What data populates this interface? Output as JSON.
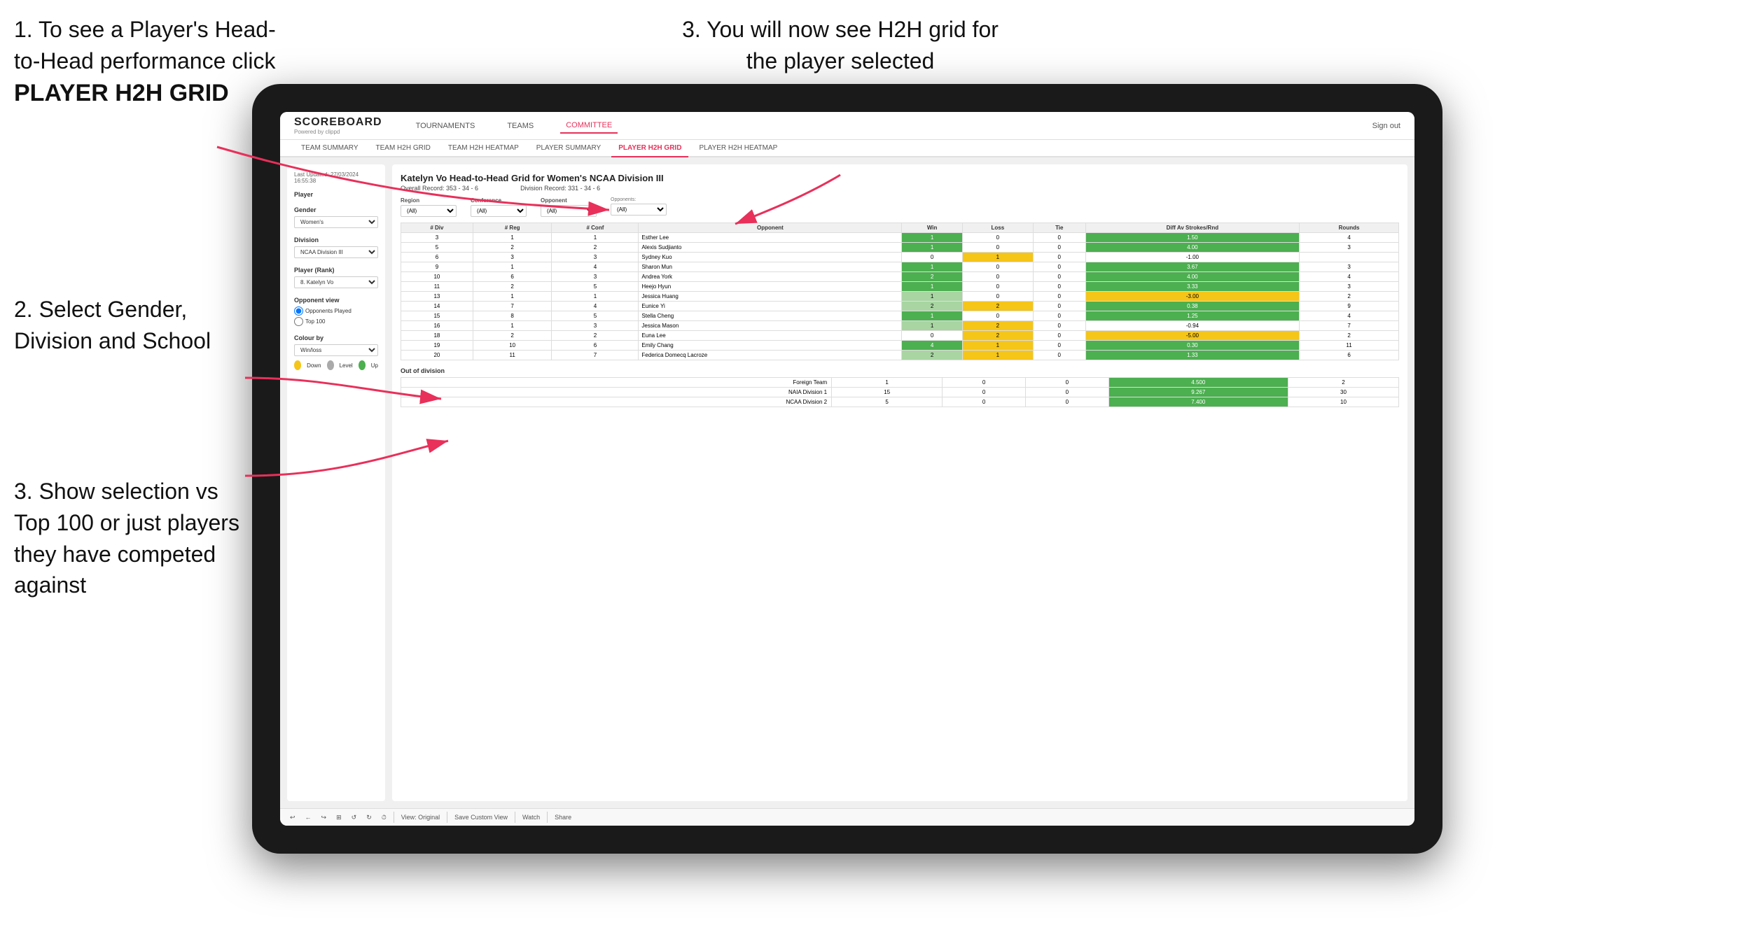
{
  "instructions": {
    "step1": "1. To see a Player's Head-to-Head performance click",
    "step1_bold": "PLAYER H2H GRID",
    "step3_top": "3. You will now see H2H grid for the player selected",
    "step2": "2. Select Gender, Division and School",
    "step3_bottom": "3. Show selection vs Top 100 or just players they have competed against"
  },
  "header": {
    "logo": "SCOREBOARD",
    "logo_sub": "Powered by clippd",
    "nav_items": [
      "TOURNAMENTS",
      "TEAMS",
      "COMMITTEE"
    ],
    "active_nav": "COMMITTEE",
    "sign_out": "Sign out"
  },
  "sub_nav": {
    "items": [
      "TEAM SUMMARY",
      "TEAM H2H GRID",
      "TEAM H2H HEATMAP",
      "PLAYER SUMMARY",
      "PLAYER H2H GRID",
      "PLAYER H2H HEATMAP"
    ],
    "active": "PLAYER H2H GRID"
  },
  "left_panel": {
    "last_updated_label": "Last Updated: 27/03/2024",
    "last_updated_time": "16:55:38",
    "player_label": "Player",
    "gender_label": "Gender",
    "gender_value": "Women's",
    "division_label": "Division",
    "division_value": "NCAA Division III",
    "player_rank_label": "Player (Rank)",
    "player_rank_value": "8. Katelyn Vo",
    "opponent_view_label": "Opponent view",
    "radio_played": "Opponents Played",
    "radio_top100": "Top 100",
    "colour_label": "Colour by",
    "colour_value": "Win/loss",
    "dot_down": "Down",
    "dot_level": "Level",
    "dot_up": "Up"
  },
  "grid": {
    "title": "Katelyn Vo Head-to-Head Grid for Women's NCAA Division III",
    "overall_record": "Overall Record: 353 - 34 - 6",
    "division_record": "Division Record: 331 - 34 - 6",
    "region_label": "Region",
    "conference_label": "Conference",
    "opponent_label": "Opponent",
    "opponents_label": "Opponents:",
    "all_option": "(All)",
    "columns": [
      "# Div",
      "# Reg",
      "# Conf",
      "Opponent",
      "Win",
      "Loss",
      "Tie",
      "Diff Av Strokes/Rnd",
      "Rounds"
    ],
    "rows": [
      {
        "div": 3,
        "reg": 1,
        "conf": 1,
        "opponent": "Esther Lee",
        "win": 1,
        "loss": 0,
        "tie": 0,
        "diff": 1.5,
        "rounds": 4,
        "win_color": "green",
        "loss_color": "white",
        "tie_color": "white"
      },
      {
        "div": 5,
        "reg": 2,
        "conf": 2,
        "opponent": "Alexis Sudjianto",
        "win": 1,
        "loss": 0,
        "tie": 0,
        "diff": 4.0,
        "rounds": 3,
        "win_color": "green",
        "loss_color": "white",
        "tie_color": "white"
      },
      {
        "div": 6,
        "reg": 3,
        "conf": 3,
        "opponent": "Sydney Kuo",
        "win": 0,
        "loss": 1,
        "tie": 0,
        "diff": -1.0,
        "rounds": "",
        "win_color": "white",
        "loss_color": "yellow",
        "tie_color": "white"
      },
      {
        "div": 9,
        "reg": 1,
        "conf": 4,
        "opponent": "Sharon Mun",
        "win": 1,
        "loss": 0,
        "tie": 0,
        "diff": 3.67,
        "rounds": 3,
        "win_color": "green",
        "loss_color": "white",
        "tie_color": "white"
      },
      {
        "div": 10,
        "reg": 6,
        "conf": 3,
        "opponent": "Andrea York",
        "win": 2,
        "loss": 0,
        "tie": 0,
        "diff": 4.0,
        "rounds": 4,
        "win_color": "green",
        "loss_color": "white",
        "tie_color": "white"
      },
      {
        "div": 11,
        "reg": 2,
        "conf": 5,
        "opponent": "Heejo Hyun",
        "win": 1,
        "loss": 0,
        "tie": 0,
        "diff": 3.33,
        "rounds": 3,
        "win_color": "green",
        "loss_color": "white",
        "tie_color": "white"
      },
      {
        "div": 13,
        "reg": 1,
        "conf": 1,
        "opponent": "Jessica Huang",
        "win": 1,
        "loss": 0,
        "tie": 0,
        "diff": -3.0,
        "rounds": 2,
        "win_color": "light-green",
        "loss_color": "white",
        "tie_color": "white"
      },
      {
        "div": 14,
        "reg": 7,
        "conf": 4,
        "opponent": "Eunice Yi",
        "win": 2,
        "loss": 2,
        "tie": 0,
        "diff": 0.38,
        "rounds": 9,
        "win_color": "light-green",
        "loss_color": "yellow",
        "tie_color": "white"
      },
      {
        "div": 15,
        "reg": 8,
        "conf": 5,
        "opponent": "Stella Cheng",
        "win": 1,
        "loss": 0,
        "tie": 0,
        "diff": 1.25,
        "rounds": 4,
        "win_color": "green",
        "loss_color": "white",
        "tie_color": "white"
      },
      {
        "div": 16,
        "reg": 1,
        "conf": 3,
        "opponent": "Jessica Mason",
        "win": 1,
        "loss": 2,
        "tie": 0,
        "diff": -0.94,
        "rounds": 7,
        "win_color": "light-green",
        "loss_color": "yellow",
        "tie_color": "white"
      },
      {
        "div": 18,
        "reg": 2,
        "conf": 2,
        "opponent": "Euna Lee",
        "win": 0,
        "loss": 2,
        "tie": 0,
        "diff": -5.0,
        "rounds": 2,
        "win_color": "white",
        "loss_color": "yellow",
        "tie_color": "white"
      },
      {
        "div": 19,
        "reg": 10,
        "conf": 6,
        "opponent": "Emily Chang",
        "win": 4,
        "loss": 1,
        "tie": 0,
        "diff": 0.3,
        "rounds": 11,
        "win_color": "green",
        "loss_color": "yellow",
        "tie_color": "white"
      },
      {
        "div": 20,
        "reg": 11,
        "conf": 7,
        "opponent": "Federica Domecq Lacroze",
        "win": 2,
        "loss": 1,
        "tie": 0,
        "diff": 1.33,
        "rounds": 6,
        "win_color": "light-green",
        "loss_color": "yellow",
        "tie_color": "white"
      }
    ],
    "out_of_division_label": "Out of division",
    "out_of_div_rows": [
      {
        "name": "Foreign Team",
        "win": 1,
        "loss": 0,
        "tie": 0,
        "diff": 4.5,
        "rounds": 2
      },
      {
        "name": "NAIA Division 1",
        "win": 15,
        "loss": 0,
        "tie": 0,
        "diff": 9.267,
        "rounds": 30
      },
      {
        "name": "NCAA Division 2",
        "win": 5,
        "loss": 0,
        "tie": 0,
        "diff": 7.4,
        "rounds": 10
      }
    ]
  },
  "toolbar": {
    "buttons": [
      "↩",
      "←",
      "↪",
      "⊞",
      "↺",
      "↻",
      "⏱"
    ],
    "view_original": "View: Original",
    "save_custom": "Save Custom View",
    "watch": "Watch",
    "share": "Share"
  }
}
